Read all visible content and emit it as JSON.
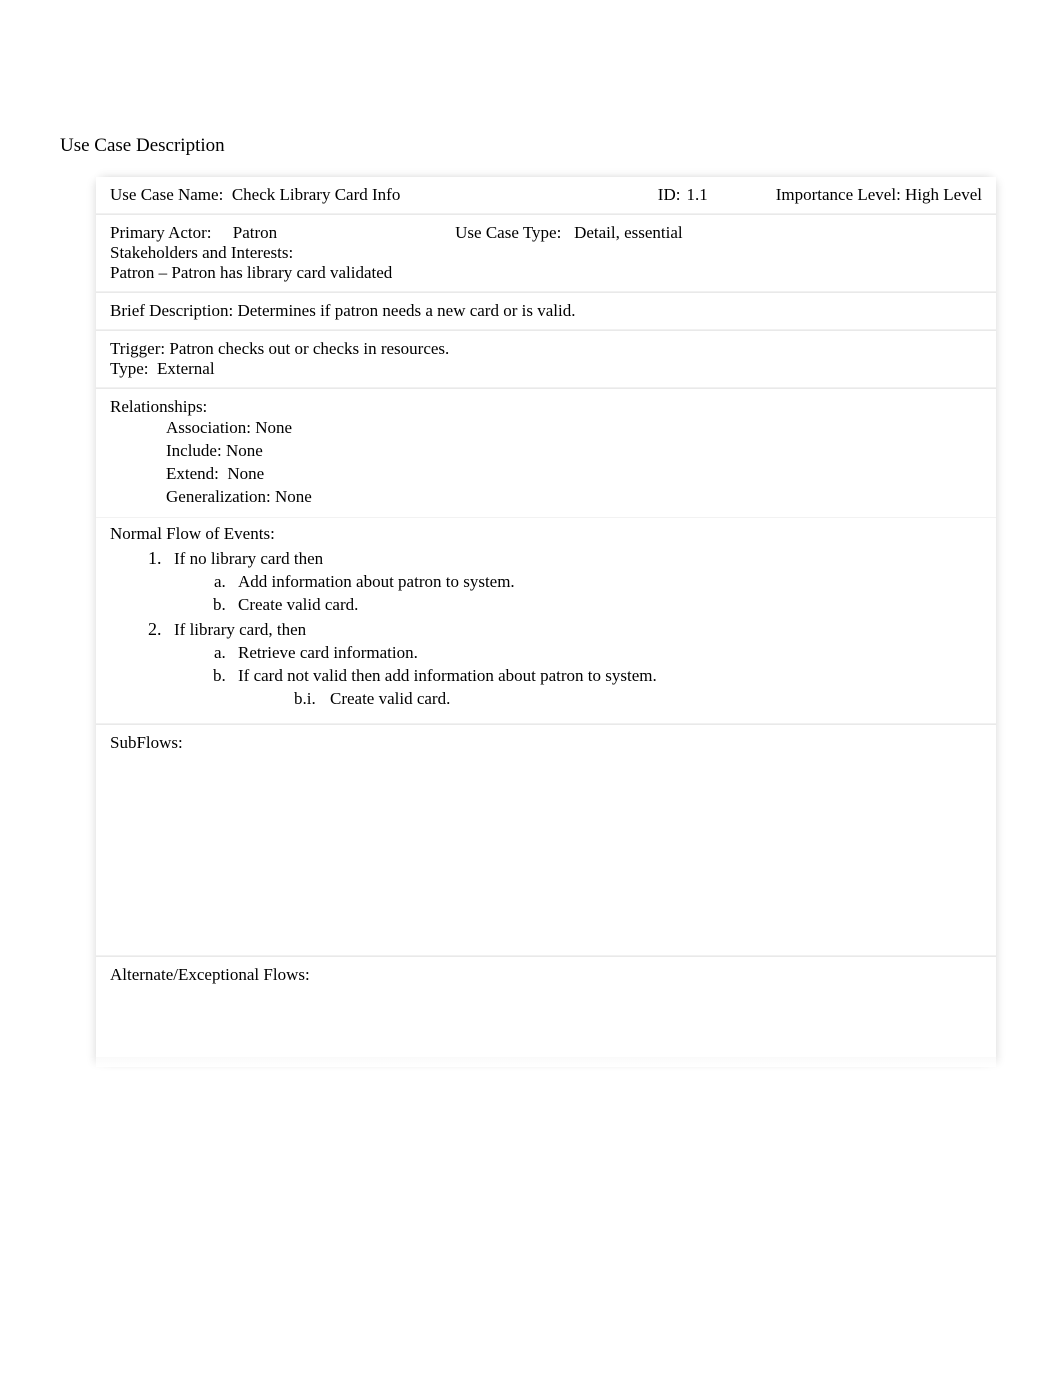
{
  "title": "Use Case Description",
  "row1": {
    "name_label": "Use Case Name:  ",
    "name_value": "Check Library Card Info",
    "id_label": "ID: ",
    "id_value": "1.1",
    "importance_label": "Importance Level: ",
    "importance_value": "High Level"
  },
  "row2": {
    "primary_actor_label": "Primary Actor:     ",
    "primary_actor_value": "Patron",
    "use_case_type_label": "Use Case Type:   ",
    "use_case_type_value": "Detail, essential",
    "stakeholders_label": "Stakeholders and Interests:",
    "stakeholders_line": "Patron – Patron has library card validated"
  },
  "row3": {
    "brief_label": "Brief Description: ",
    "brief_value": "Determines if patron needs a new card or is valid."
  },
  "row4": {
    "trigger_label": "Trigger: ",
    "trigger_value": "Patron checks out or checks in resources.",
    "type_label": "Type:  ",
    "type_value": "External"
  },
  "row5": {
    "relationships_label": "Relationships:",
    "items": [
      {
        "k": "Association: ",
        "v": "None"
      },
      {
        "k": "Include: ",
        "v": "None"
      },
      {
        "k": "Extend:  ",
        "v": "None"
      },
      {
        "k": "Generalization: ",
        "v": "None"
      }
    ]
  },
  "flow": {
    "title": "Normal Flow of Events:",
    "items": [
      {
        "text": "If no library card then",
        "sub": [
          {
            "text": "Add information about patron to system."
          },
          {
            "text": "Create valid card."
          }
        ]
      },
      {
        "text": "If library card, then",
        "sub": [
          {
            "text": "Retrieve card information."
          },
          {
            "text": "If card not valid then add information about patron to system.",
            "sub3": {
              "marker": "b.i.",
              "text": "Create valid card."
            }
          }
        ]
      }
    ]
  },
  "subflows_label": "SubFlows:",
  "alt_label": "Alternate/Exceptional Flows:"
}
